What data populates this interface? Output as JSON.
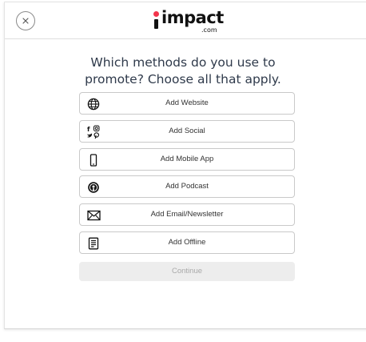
{
  "header": {
    "close_icon": "close-icon",
    "logo_text": "impact",
    "logo_suffix": ".com",
    "logo_dot_color": "#f3354c"
  },
  "main": {
    "heading_line1": "Which methods do you use to",
    "heading_line2": "promote? Choose all that apply.",
    "options": [
      {
        "label": "Add Website",
        "icon": "globe-icon"
      },
      {
        "label": "Add Social",
        "icon": "social-icons"
      },
      {
        "label": "Add Mobile App",
        "icon": "mobile-phone-icon"
      },
      {
        "label": "Add Podcast",
        "icon": "podcast-icon"
      },
      {
        "label": "Add Email/Newsletter",
        "icon": "envelope-icon"
      },
      {
        "label": "Add Offline",
        "icon": "document-icon"
      }
    ],
    "continue_label": "Continue"
  },
  "colors": {
    "heading": "#2f3a4b",
    "option_border": "#c9c9c9",
    "continue_bg": "#ededed",
    "continue_text": "#a9a9a9"
  }
}
